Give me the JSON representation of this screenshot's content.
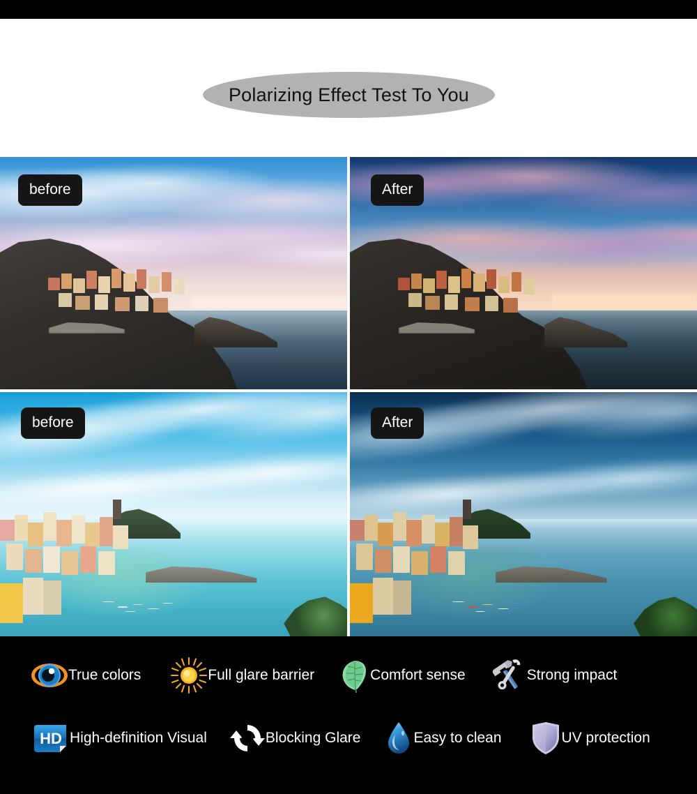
{
  "header": {
    "title": "Polarizing Effect Test To You",
    "pill_color": "#b2b2b2"
  },
  "comparison": {
    "rows": [
      {
        "before": {
          "label": "before",
          "scene": "Manarola cliff village at dusk, pastel blue and pink sky, calm sea"
        },
        "after": {
          "label": "After",
          "scene": "Manarola cliff village at dusk, saturated purple and orange sunset sky, deep sea"
        }
      },
      {
        "before": {
          "label": "before",
          "scene": "Vernazza harbour, washed-out bright cyan sky and pale turquoise bay"
        },
        "after": {
          "label": "After",
          "scene": "Vernazza harbour, deep saturated blue sky with dramatic clouds and teal bay"
        }
      }
    ]
  },
  "features": {
    "background_color": "#000000",
    "text_color": "#ffffff",
    "rows": [
      [
        {
          "icon": "eye-icon",
          "label": "True colors",
          "icon_color": "#1f7ec8"
        },
        {
          "icon": "sun-icon",
          "label": "Full glare barrier",
          "icon_color": "#f5a623"
        },
        {
          "icon": "leaf-icon",
          "label": "Comfort sense",
          "icon_color": "#7ed39a"
        },
        {
          "icon": "tools-icon",
          "label": "Strong impact",
          "icon_color": "#4a7fb5"
        }
      ],
      [
        {
          "icon": "hd-badge-icon",
          "label": "High-definition Visual",
          "icon_color": "#1f88d4"
        },
        {
          "icon": "recycle-icon",
          "label": "Blocking Glare",
          "icon_color": "#ffffff"
        },
        {
          "icon": "water-drop-icon",
          "label": "Easy to clean",
          "icon_color": "#2b8fd8"
        },
        {
          "icon": "shield-icon",
          "label": "UV protection",
          "icon_color": "#a9a6d6"
        }
      ]
    ]
  }
}
